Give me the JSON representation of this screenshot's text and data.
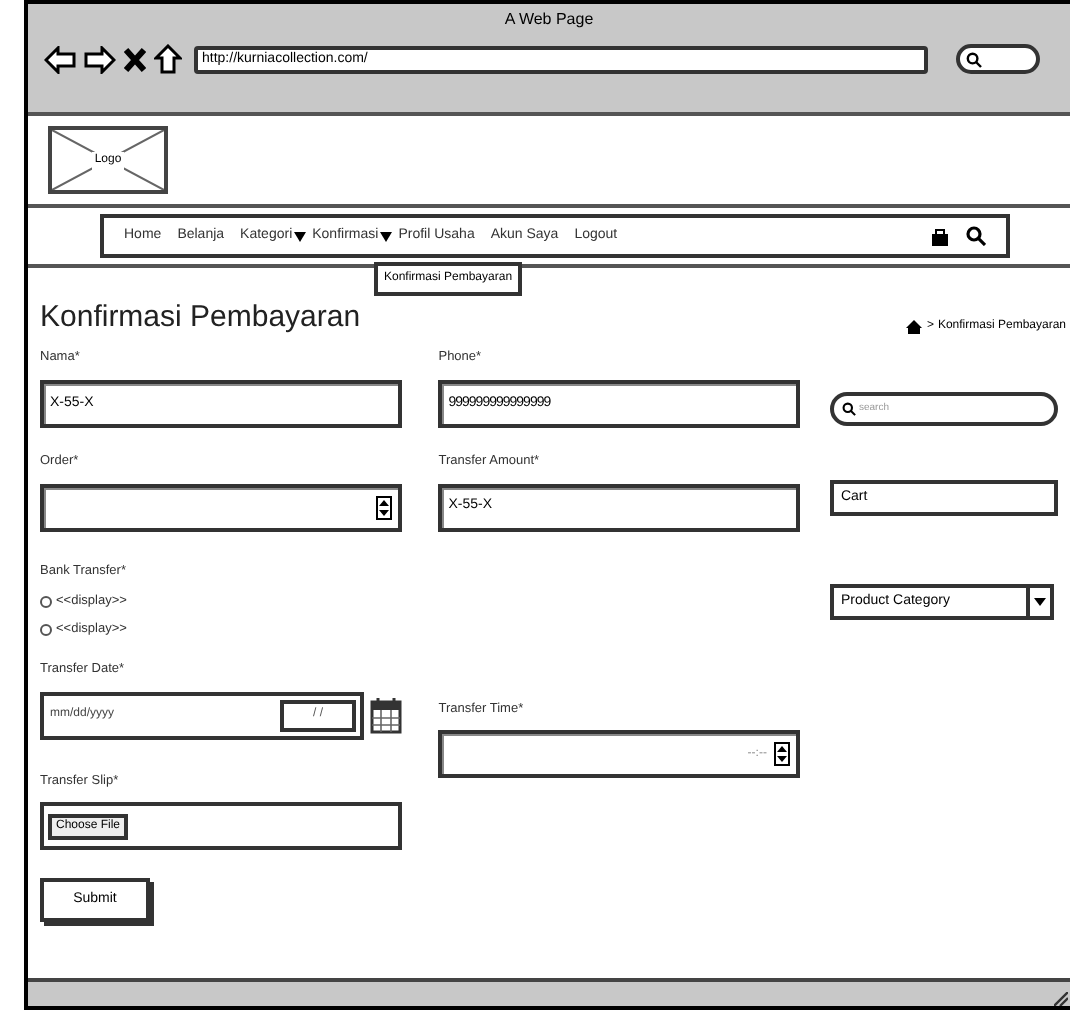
{
  "browser": {
    "title": "A Web Page",
    "url": "http://kurniacollection.com/"
  },
  "logo": {
    "label": "Logo"
  },
  "nav": {
    "items": [
      {
        "label": "Home",
        "kind": "link"
      },
      {
        "label": "Belanja",
        "kind": "link"
      },
      {
        "label": "Kategori",
        "kind": "dropdown"
      },
      {
        "label": "Konfirmasi",
        "kind": "dropdown"
      },
      {
        "label": "Profil Usaha",
        "kind": "link"
      },
      {
        "label": "Akun Saya",
        "kind": "link"
      },
      {
        "label": "Logout",
        "kind": "link"
      }
    ],
    "dropdown_menu": {
      "items": [
        "Konfirmasi Pembayaran"
      ]
    }
  },
  "heading": "Konfirmasi Pembayaran",
  "breadcrumb": {
    "separator": ">",
    "current": "Konfirmasi Pembayaran"
  },
  "form": {
    "name": {
      "label": "Nama*",
      "value": "X-55-X"
    },
    "phone": {
      "label": "Phone*",
      "value": "999999999999999"
    },
    "order": {
      "label": "Order*"
    },
    "transfer_amount": {
      "label": "Transfer Amount*",
      "value": "X-55-X"
    },
    "bank_transfer": {
      "label": "Bank Transfer*",
      "options": [
        {
          "label": "<<display>>",
          "selected": false
        },
        {
          "label": "<<display>>",
          "selected": false
        }
      ]
    },
    "transfer_date": {
      "label": "Transfer Date*",
      "placeholder": "mm/dd/yyyy",
      "inner": "/ /"
    },
    "transfer_time": {
      "label": "Transfer Time*",
      "placeholder": "--:--"
    },
    "transfer_slip": {
      "label": "Transfer Slip*",
      "button": "Choose File"
    },
    "submit": "Submit"
  },
  "sidebar": {
    "search": {
      "placeholder": "search"
    },
    "cart": "Cart",
    "category": "Product Category"
  }
}
